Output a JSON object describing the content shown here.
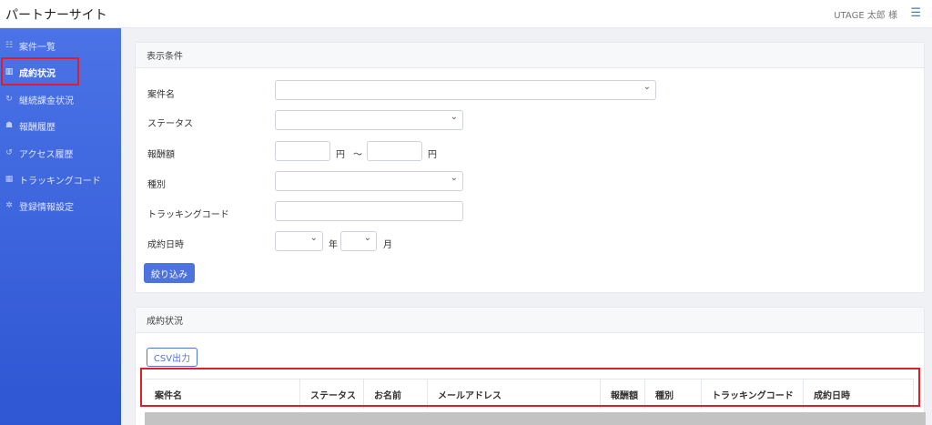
{
  "header": {
    "brand": "パートナーサイト",
    "user": "UTAGE 太郎 様",
    "menu_icon": "hamburger-icon"
  },
  "sidebar": {
    "items": [
      {
        "label": "案件一覧",
        "icon": "list-icon",
        "glyph": "☷"
      },
      {
        "label": "成約状況",
        "icon": "chart-icon",
        "glyph": "▥",
        "active": true
      },
      {
        "label": "継続課金状況",
        "icon": "refresh-icon",
        "glyph": "↻"
      },
      {
        "label": "報酬履歴",
        "icon": "coins-icon",
        "glyph": "☗"
      },
      {
        "label": "アクセス履歴",
        "icon": "history-icon",
        "glyph": "↺"
      },
      {
        "label": "トラッキングコード",
        "icon": "barcode-icon",
        "glyph": "▦"
      },
      {
        "label": "登録情報設定",
        "icon": "gear-icon",
        "glyph": "✲"
      }
    ]
  },
  "filter": {
    "title": "表示条件",
    "labels": {
      "project": "案件名",
      "status": "ステータス",
      "reward": "報酬額",
      "type": "種別",
      "tracking": "トラッキングコード",
      "date": "成約日時"
    },
    "yen": "円",
    "tilde": "〜",
    "year": "年",
    "month": "月",
    "submit": "絞り込み"
  },
  "results": {
    "title": "成約状況",
    "csv": "CSV出力",
    "columns": [
      "案件名",
      "ステータス",
      "お名前",
      "メールアドレス",
      "報酬額",
      "種別",
      "トラッキングコード",
      "成約日時"
    ]
  },
  "colors": {
    "sidebar": "#3a62dc",
    "accent": "#4e73df",
    "highlight": "#e01e2a"
  }
}
